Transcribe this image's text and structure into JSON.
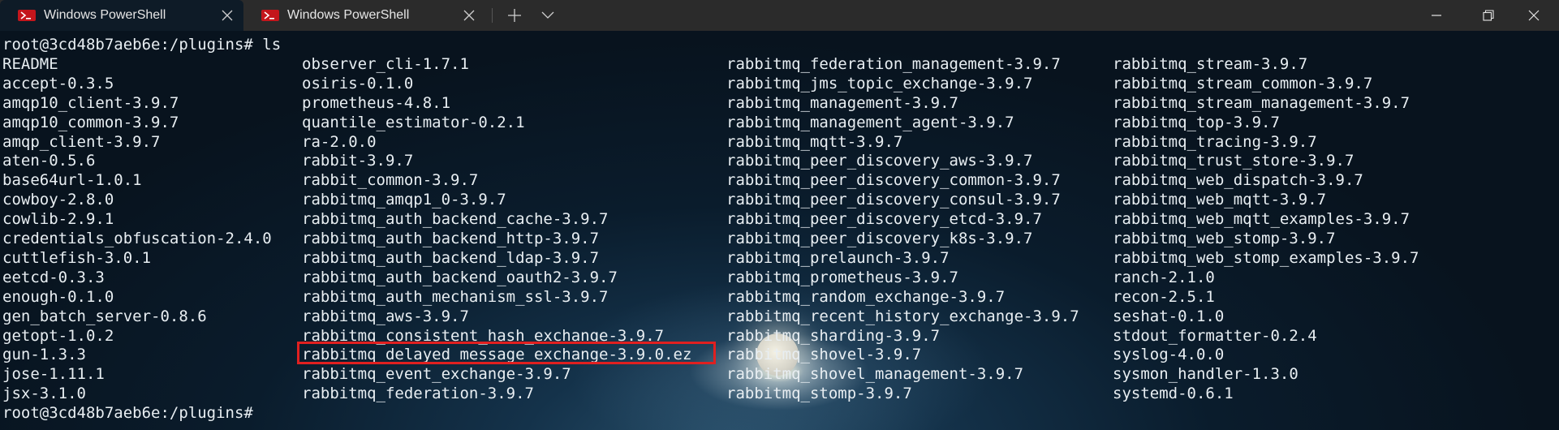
{
  "tabs": [
    {
      "label": "Windows PowerShell",
      "active": true
    },
    {
      "label": "Windows PowerShell",
      "active": false
    }
  ],
  "window_controls": {
    "new_tab": "+",
    "dropdown": "chevron-down-icon",
    "minimize": "minimize-icon",
    "maximize": "maximize-icon",
    "close": "close-icon"
  },
  "terminal": {
    "prompt_command": "root@3cd48b7aeb6e:/plugins# ls",
    "prompt_end": "root@3cd48b7aeb6e:/plugins#",
    "columns": [
      [
        "README",
        "accept-0.3.5",
        "amqp10_client-3.9.7",
        "amqp10_common-3.9.7",
        "amqp_client-3.9.7",
        "aten-0.5.6",
        "base64url-1.0.1",
        "cowboy-2.8.0",
        "cowlib-2.9.1",
        "credentials_obfuscation-2.4.0",
        "cuttlefish-3.0.1",
        "eetcd-0.3.3",
        "enough-0.1.0",
        "gen_batch_server-0.8.6",
        "getopt-1.0.2",
        "gun-1.3.3",
        "jose-1.11.1",
        "jsx-3.1.0"
      ],
      [
        "observer_cli-1.7.1",
        "osiris-0.1.0",
        "prometheus-4.8.1",
        "quantile_estimator-0.2.1",
        "ra-2.0.0",
        "rabbit-3.9.7",
        "rabbit_common-3.9.7",
        "rabbitmq_amqp1_0-3.9.7",
        "rabbitmq_auth_backend_cache-3.9.7",
        "rabbitmq_auth_backend_http-3.9.7",
        "rabbitmq_auth_backend_ldap-3.9.7",
        "rabbitmq_auth_backend_oauth2-3.9.7",
        "rabbitmq_auth_mechanism_ssl-3.9.7",
        "rabbitmq_aws-3.9.7",
        "rabbitmq_consistent_hash_exchange-3.9.7",
        "rabbitmq_delayed_message_exchange-3.9.0.ez",
        "rabbitmq_event_exchange-3.9.7",
        "rabbitmq_federation-3.9.7"
      ],
      [
        "rabbitmq_federation_management-3.9.7",
        "rabbitmq_jms_topic_exchange-3.9.7",
        "rabbitmq_management-3.9.7",
        "rabbitmq_management_agent-3.9.7",
        "rabbitmq_mqtt-3.9.7",
        "rabbitmq_peer_discovery_aws-3.9.7",
        "rabbitmq_peer_discovery_common-3.9.7",
        "rabbitmq_peer_discovery_consul-3.9.7",
        "rabbitmq_peer_discovery_etcd-3.9.7",
        "rabbitmq_peer_discovery_k8s-3.9.7",
        "rabbitmq_prelaunch-3.9.7",
        "rabbitmq_prometheus-3.9.7",
        "rabbitmq_random_exchange-3.9.7",
        "rabbitmq_recent_history_exchange-3.9.7",
        "rabbitmq_sharding-3.9.7",
        "rabbitmq_shovel-3.9.7",
        "rabbitmq_shovel_management-3.9.7",
        "rabbitmq_stomp-3.9.7"
      ],
      [
        "rabbitmq_stream-3.9.7",
        "rabbitmq_stream_common-3.9.7",
        "rabbitmq_stream_management-3.9.7",
        "rabbitmq_top-3.9.7",
        "rabbitmq_tracing-3.9.7",
        "rabbitmq_trust_store-3.9.7",
        "rabbitmq_web_dispatch-3.9.7",
        "rabbitmq_web_mqtt-3.9.7",
        "rabbitmq_web_mqtt_examples-3.9.7",
        "rabbitmq_web_stomp-3.9.7",
        "rabbitmq_web_stomp_examples-3.9.7",
        "ranch-2.1.0",
        "recon-2.5.1",
        "seshat-0.1.0",
        "stdout_formatter-0.2.4",
        "syslog-4.0.0",
        "sysmon_handler-1.3.0",
        "systemd-0.6.1"
      ]
    ],
    "highlighted_item": "rabbitmq_delayed_message_exchange-3.9.0.ez",
    "highlight_color": "#e02020"
  }
}
